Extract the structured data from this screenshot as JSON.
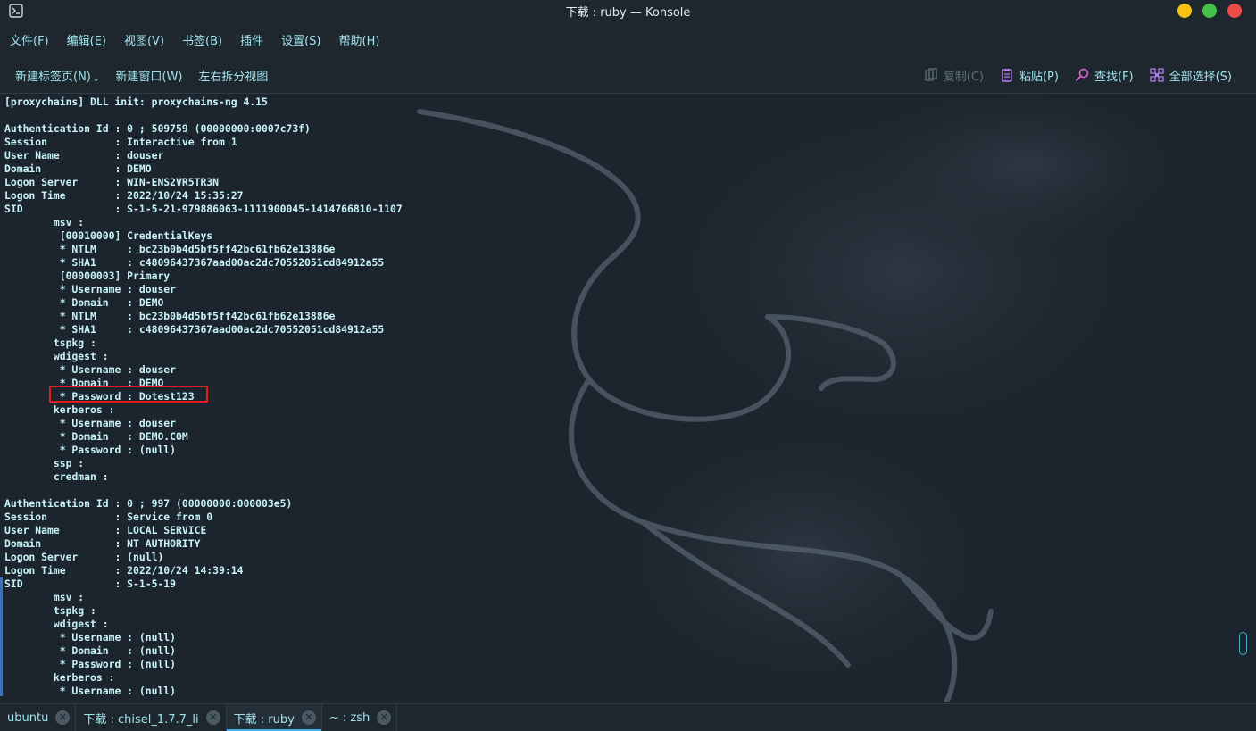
{
  "window": {
    "title": "下载 : ruby — Konsole",
    "icon": "terminal-app-icon"
  },
  "menubar": {
    "items": [
      "文件(F)",
      "编辑(E)",
      "视图(V)",
      "书签(B)",
      "插件",
      "设置(S)",
      "帮助(H)"
    ]
  },
  "toolbar": {
    "new_tab": "新建标签页(N)",
    "new_window": "新建窗口(W)",
    "split_view": "左右拆分视图",
    "copy": "复制(C)",
    "paste": "粘贴(P)",
    "find": "查找(F)",
    "select_all": "全部选择(S)"
  },
  "terminal": {
    "lines": [
      "[proxychains] DLL init: proxychains-ng 4.15",
      "",
      "Authentication Id : 0 ; 509759 (00000000:0007c73f)",
      "Session           : Interactive from 1",
      "User Name         : douser",
      "Domain            : DEMO",
      "Logon Server      : WIN-ENS2VR5TR3N",
      "Logon Time        : 2022/10/24 15:35:27",
      "SID               : S-1-5-21-979886063-1111900045-1414766810-1107",
      "        msv :",
      "         [00010000] CredentialKeys",
      "         * NTLM     : bc23b0b4d5bf5ff42bc61fb62e13886e",
      "         * SHA1     : c48096437367aad00ac2dc70552051cd84912a55",
      "         [00000003] Primary",
      "         * Username : douser",
      "         * Domain   : DEMO",
      "         * NTLM     : bc23b0b4d5bf5ff42bc61fb62e13886e",
      "         * SHA1     : c48096437367aad00ac2dc70552051cd84912a55",
      "        tspkg :",
      "        wdigest :",
      "         * Username : douser",
      "         * Domain   : DEMO",
      "         * Password : Dotest123",
      "        kerberos :",
      "         * Username : douser",
      "         * Domain   : DEMO.COM",
      "         * Password : (null)",
      "        ssp :",
      "        credman :",
      "",
      "Authentication Id : 0 ; 997 (00000000:000003e5)",
      "Session           : Service from 0",
      "User Name         : LOCAL SERVICE",
      "Domain            : NT AUTHORITY",
      "Logon Server      : (null)",
      "Logon Time        : 2022/10/24 14:39:14",
      "SID               : S-1-5-19",
      "        msv :",
      "        tspkg :",
      "        wdigest :",
      "         * Username : (null)",
      "         * Domain   : (null)",
      "         * Password : (null)",
      "        kerberos :",
      "         * Username : (null)"
    ],
    "highlight_color": "#e11d1d"
  },
  "tabs": [
    {
      "label": "ubuntu",
      "active": false
    },
    {
      "label": "下载 : chisel_1.7.7_li",
      "active": false
    },
    {
      "label": "下载 : ruby",
      "active": true
    },
    {
      "label": "~ : zsh",
      "active": false
    }
  ],
  "colors": {
    "accent": "#3daee9",
    "menu_text": "#9fe3ec",
    "terminal_text": "#c8f4f6"
  }
}
